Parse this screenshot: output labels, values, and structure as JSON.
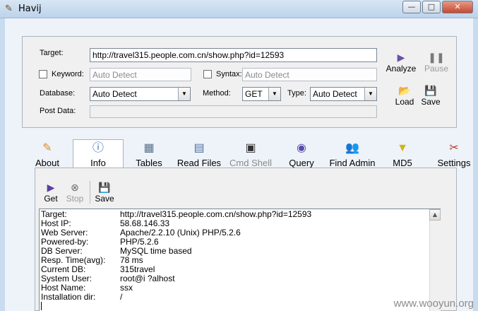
{
  "window": {
    "title": "Havij",
    "minimize": "—",
    "maximize": "□",
    "close": "✕"
  },
  "form": {
    "target_label": "Target:",
    "target_value": "http://travel315.people.com.cn/show.php?id=12593",
    "keyword_label": "Keyword:",
    "keyword_placeholder": "Auto Detect",
    "syntax_label": "Syntax:",
    "syntax_placeholder": "Auto Detect",
    "database_label": "Database:",
    "database_value": "Auto Detect",
    "method_label": "Method:",
    "method_value": "GET",
    "type_label": "Type:",
    "type_value": "Auto Detect",
    "postdata_label": "Post Data:"
  },
  "actions": {
    "analyze": "Analyze",
    "pause": "Pause",
    "load": "Load",
    "save": "Save"
  },
  "tabs": [
    {
      "label": "About",
      "icon": "about-icon"
    },
    {
      "label": "Info",
      "icon": "info-icon"
    },
    {
      "label": "Tables",
      "icon": "tables-icon"
    },
    {
      "label": "Read Files",
      "icon": "read-files-icon"
    },
    {
      "label": "Cmd Shell",
      "icon": "cmd-shell-icon"
    },
    {
      "label": "Query",
      "icon": "query-icon"
    },
    {
      "label": "Find Admin",
      "icon": "find-admin-icon"
    },
    {
      "label": "MD5",
      "icon": "md5-icon"
    },
    {
      "label": "Settings",
      "icon": "settings-icon"
    }
  ],
  "info_toolbar": {
    "get": "Get",
    "stop": "Stop",
    "save": "Save"
  },
  "info": [
    {
      "key": "Target:",
      "value": "http://travel315.people.com.cn/show.php?id=12593"
    },
    {
      "key": "Host IP:",
      "value": "58.68.146.33"
    },
    {
      "key": "Web Server:",
      "value": "Apache/2.2.10 (Unix) PHP/5.2.6"
    },
    {
      "key": "Powered-by:",
      "value": "PHP/5.2.6"
    },
    {
      "key": "DB Server:",
      "value": "MySQL time based"
    },
    {
      "key": "Resp. Time(avg):",
      "value": "78 ms"
    },
    {
      "key": "Current DB:",
      "value": "315travel"
    },
    {
      "key": "System User:",
      "value": "root@i ?alhost"
    },
    {
      "key": "Host Name:",
      "value": "ssx"
    },
    {
      "key": "Installation dir:",
      "value": "/"
    }
  ],
  "watermark": "www.wooyun.org"
}
